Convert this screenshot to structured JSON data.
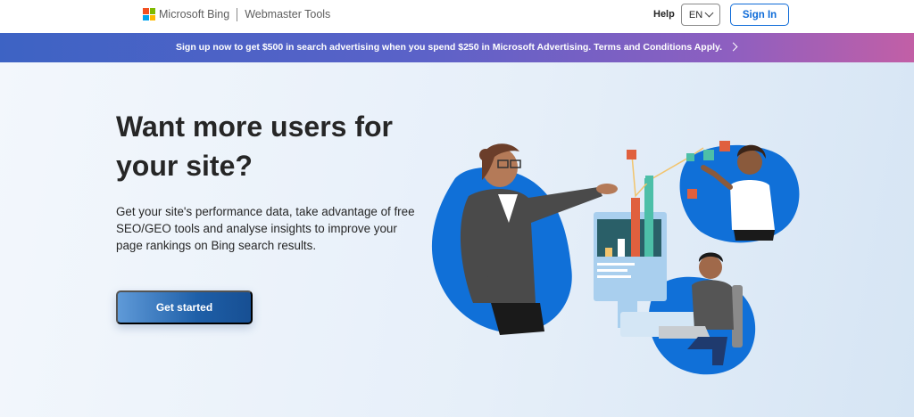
{
  "header": {
    "brand": "Microsoft Bing",
    "product": "Webmaster Tools",
    "help_label": "Help",
    "language": "EN",
    "signin_label": "Sign In"
  },
  "banner": {
    "text": "Sign up now to get $500 in search advertising when you spend $250 in Microsoft Advertising.   Terms and Conditions Apply."
  },
  "hero": {
    "title": "Want more users for your site?",
    "description": "Get your site's performance data, take advantage of free SEO/GEO tools and analyse insights to improve your page rankings on Bing search results.",
    "cta_label": "Get started"
  },
  "colors": {
    "microsoft_red": "#f25022",
    "microsoft_green": "#7fba00",
    "microsoft_blue": "#00a4ef",
    "microsoft_yellow": "#ffb900",
    "accent_blue": "#0e6bd8",
    "illustration_blue": "#1070d8"
  },
  "icons": {
    "logo": "microsoft-logo-icon",
    "language_chevron": "chevron-down-icon",
    "banner_chevron": "chevron-right-icon"
  }
}
